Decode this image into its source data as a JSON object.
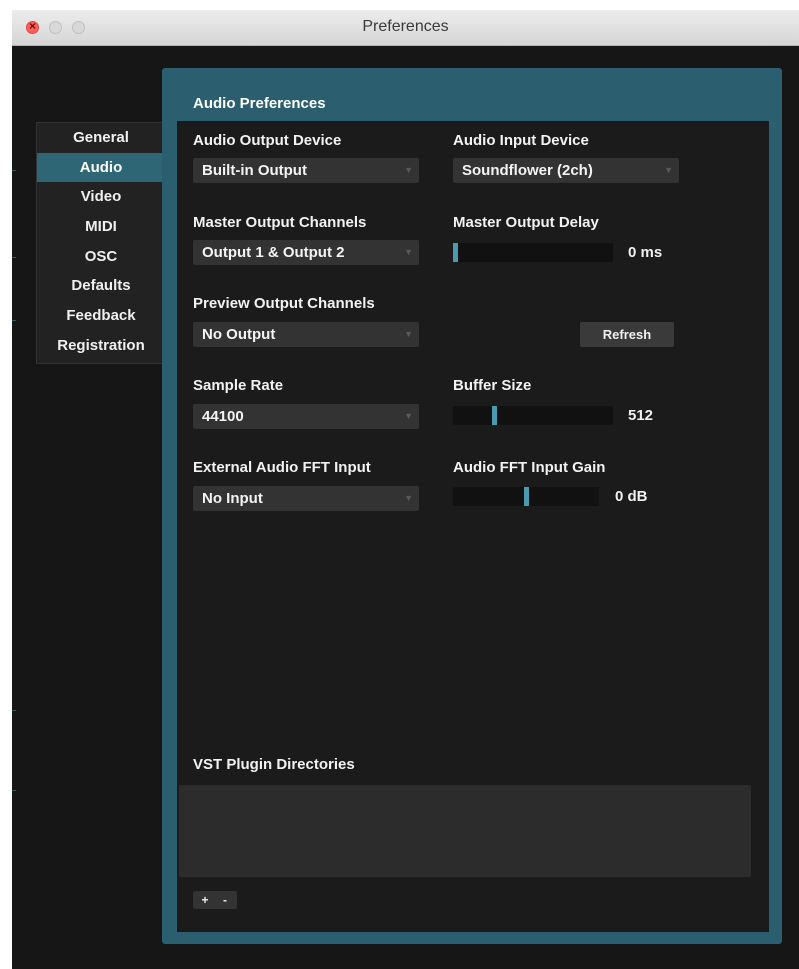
{
  "window": {
    "title": "Preferences"
  },
  "sidebar": {
    "items": [
      {
        "label": "General",
        "active": false
      },
      {
        "label": "Audio",
        "active": true
      },
      {
        "label": "Video",
        "active": false
      },
      {
        "label": "MIDI",
        "active": false
      },
      {
        "label": "OSC",
        "active": false
      },
      {
        "label": "Defaults",
        "active": false
      },
      {
        "label": "Feedback",
        "active": false
      },
      {
        "label": "Registration",
        "active": false
      }
    ]
  },
  "panel": {
    "title": "Audio Preferences",
    "audio_output_device": {
      "label": "Audio Output Device",
      "value": "Built-in Output"
    },
    "audio_input_device": {
      "label": "Audio Input Device",
      "value": "Soundflower (2ch)"
    },
    "master_output_channels": {
      "label": "Master Output Channels",
      "value": "Output 1 & Output 2"
    },
    "master_output_delay": {
      "label": "Master Output Delay",
      "value": "0 ms",
      "level": 0.0
    },
    "preview_output_channels": {
      "label": "Preview Output Channels",
      "value": "No Output"
    },
    "refresh_button": "Refresh",
    "sample_rate": {
      "label": "Sample Rate",
      "value": "44100"
    },
    "buffer_size": {
      "label": "Buffer Size",
      "value": "512",
      "level": 0.25
    },
    "external_fft_input": {
      "label": "External Audio FFT Input",
      "value": "No Input"
    },
    "fft_input_gain": {
      "label": "Audio FFT Input Gain",
      "value": "0 dB",
      "level": 0.5
    },
    "vst": {
      "label": "VST Plugin Directories",
      "add": "+",
      "remove": "-"
    }
  },
  "colors": {
    "accent": "#2b5e6e",
    "active_item": "#2e6675",
    "slider_thumb": "#4a9bb0"
  }
}
